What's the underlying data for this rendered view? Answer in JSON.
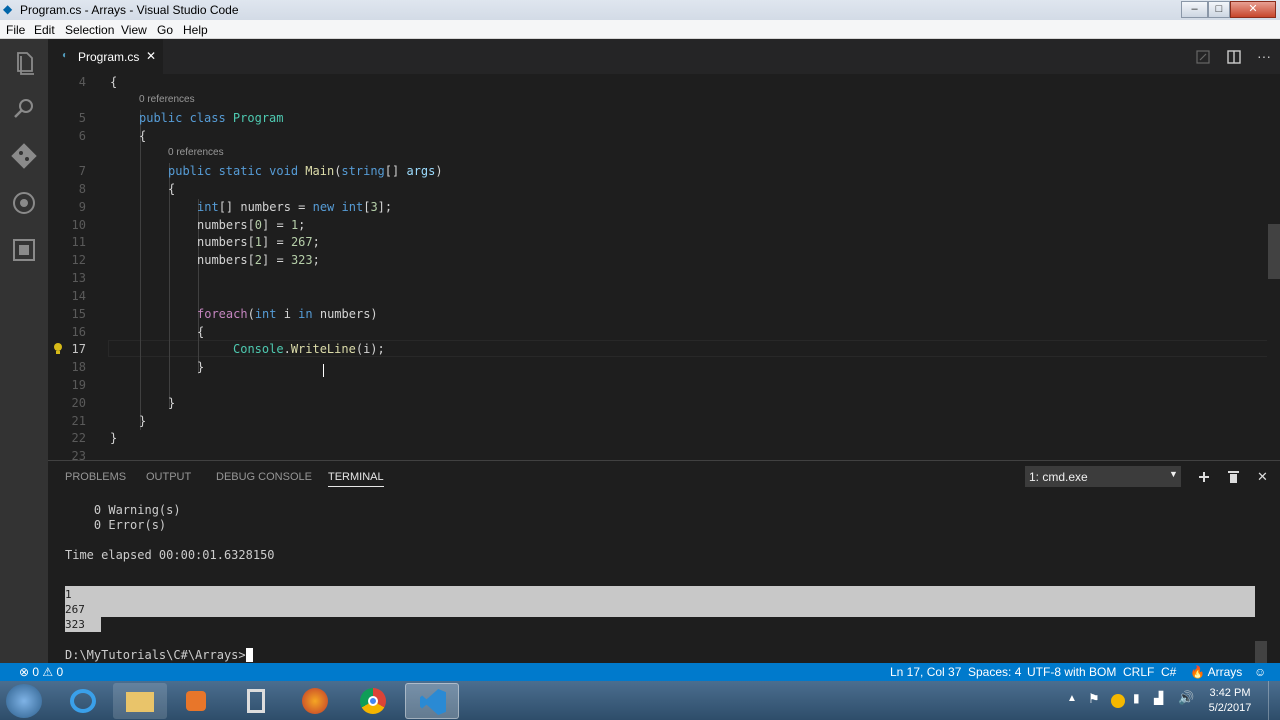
{
  "window": {
    "title": "Program.cs - Arrays - Visual Studio Code"
  },
  "menu": [
    "File",
    "Edit",
    "Selection",
    "View",
    "Go",
    "Help"
  ],
  "tab": {
    "label": "Program.cs"
  },
  "editor": {
    "references_label": "0 references",
    "line_numbers": [
      "4",
      "5",
      "6",
      "7",
      "8",
      "9",
      "10",
      "11",
      "12",
      "13",
      "14",
      "15",
      "16",
      "17",
      "18",
      "19",
      "20",
      "21",
      "22",
      "23"
    ],
    "lines": {
      "l4": "{",
      "l5_kw": "public class ",
      "l5_ty": "Program",
      "l6": "{",
      "l7_kw": "public static void ",
      "l7_fn": "Main",
      "l7_a": "(",
      "l7_kw2": "string",
      "l7_b": "[] ",
      "l7_pa": "args",
      "l7_c": ")",
      "l8": "{",
      "l9_kw": "int",
      "l9_a": "[] numbers = ",
      "l9_kw2": "new ",
      "l9_kw3": "int",
      "l9_b": "[",
      "l9_nu": "3",
      "l9_c": "];",
      "l10_a": "numbers[",
      "l10_n1": "0",
      "l10_b": "] = ",
      "l10_n2": "1",
      "l10_c": ";",
      "l11_a": "numbers[",
      "l11_n1": "1",
      "l11_b": "] = ",
      "l11_n2": "267",
      "l11_c": ";",
      "l12_a": "numbers[",
      "l12_n1": "2",
      "l12_b": "] = ",
      "l12_n2": "323",
      "l12_c": ";",
      "l15_ctl": "foreach",
      "l15_a": "(",
      "l15_kw": "int ",
      "l15_b": "i ",
      "l15_kw2": "in ",
      "l15_c": "numbers)",
      "l16": "{",
      "l17_ty": "Console",
      "l17_a": ".",
      "l17_fn": "WriteLine",
      "l17_b": "(i);",
      "l18": "}",
      "l20": "}",
      "l21": "}",
      "l22": "}"
    }
  },
  "panel": {
    "tabs": [
      "PROBLEMS",
      "OUTPUT",
      "DEBUG CONSOLE",
      "TERMINAL"
    ],
    "active_tab": "TERMINAL",
    "terminal_select": "1: cmd.exe",
    "terminal_lines": {
      "warnings": "    0 Warning(s)",
      "errors": "    0 Error(s)",
      "elapsed": "Time elapsed 00:00:01.6328150",
      "out1": "1",
      "out2": "267",
      "out3": "323",
      "prompt": "D:\\MyTutorials\\C#\\Arrays>"
    }
  },
  "status": {
    "errors": "0",
    "warnings": "0",
    "position": "Ln 17, Col 37",
    "spaces": "Spaces: 4",
    "encoding": "UTF-8 with BOM",
    "eol": "CRLF",
    "language": "C#",
    "project": "Arrays"
  },
  "taskbar": {
    "time": "3:42 PM",
    "date": "5/2/2017"
  },
  "colors": {
    "accent": "#007acc",
    "editor_bg": "#1e1e1e",
    "keyword": "#569cd6",
    "type": "#4ec9b0",
    "number": "#b5cea8"
  }
}
